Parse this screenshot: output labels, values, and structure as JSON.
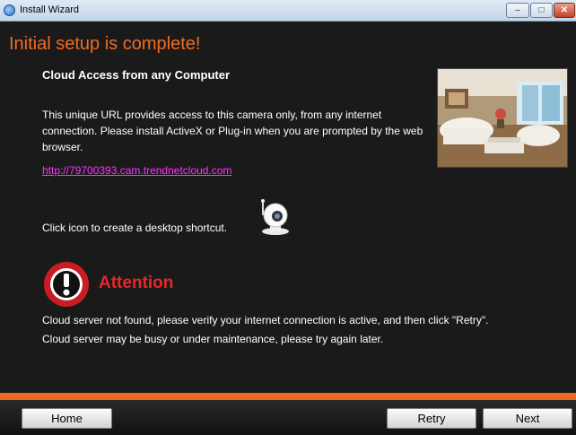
{
  "window": {
    "title": "Install Wizard",
    "min_glyph": "–",
    "max_glyph": "□",
    "close_glyph": "✕"
  },
  "page": {
    "heading": "Initial setup is complete!",
    "subheading": "Cloud Access from any Computer",
    "paragraph": "This unique URL provides access to this camera only, from any internet connection. Please install ActiveX or Plug-in when you are prompted by the web browser.",
    "link": "http://79700393.cam.trendnetcloud.com",
    "shortcut_text": "Click icon to create a desktop shortcut.",
    "attention_title": "Attention",
    "attention_message_1": "Cloud server not found, please verify your internet connection is active, and then click \"Retry\".",
    "attention_message_2": "Cloud server may be busy or under maintenance, please try again later."
  },
  "footer": {
    "home_label": "Home",
    "retry_label": "Retry",
    "next_label": "Next"
  },
  "colors": {
    "accent": "#ee6a22",
    "heading": "#f26b22",
    "link": "#ff33ff",
    "attention": "#e8262a",
    "background": "#1a1a1a"
  },
  "icons": {
    "app": "install-wizard-icon",
    "camera": "camera-icon",
    "attention": "exclamation-circle-icon",
    "photo": "living-room-photo"
  }
}
